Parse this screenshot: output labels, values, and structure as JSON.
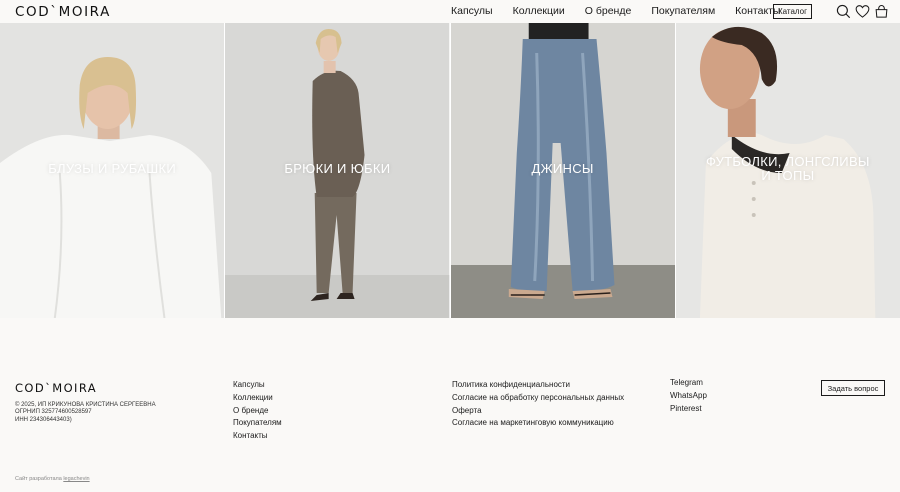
{
  "header": {
    "logo": "COD`MOIRA",
    "nav": [
      "Капсулы",
      "Коллекции",
      "О бренде",
      "Покупателям",
      "Контакты"
    ],
    "catalog_button": "Каталог",
    "icons": [
      "search-icon",
      "heart-icon",
      "bag-icon"
    ]
  },
  "categories": [
    {
      "label": "БЛУЗЫ И РУБАШКИ"
    },
    {
      "label": "БРЮКИ И ЮБКИ"
    },
    {
      "label": "ДЖИНСЫ"
    },
    {
      "label": "ФУТБОЛКИ, ЛОНГСЛИВЫ И ТОПЫ"
    }
  ],
  "footer": {
    "logo": "COD`MOIRA",
    "legal": [
      "© 2025, ИП КРИКУНОВА КРИСТИНА СЕРГЕЕВНА",
      "ОГРНИП 325774600528597",
      "ИНН 234306443403)"
    ],
    "menu": [
      "Капсулы",
      "Коллекции",
      "О бренде",
      "Покупателям",
      "Контакты"
    ],
    "policies": [
      "Политика конфиденциальности",
      "Согласие на обработку персональных данных",
      "Оферта",
      "Согласие на маркетинговую коммуникацию"
    ],
    "social": [
      "Telegram",
      "WhatsApp",
      "Pinterest"
    ],
    "ask_button": "Задать вопрос",
    "credit_prefix": "Сайт разработала",
    "credit_link": "legachevin"
  },
  "colors": {
    "background": "#faf9f7",
    "text": "#1b1b1b",
    "category_label": "#ffffff"
  }
}
